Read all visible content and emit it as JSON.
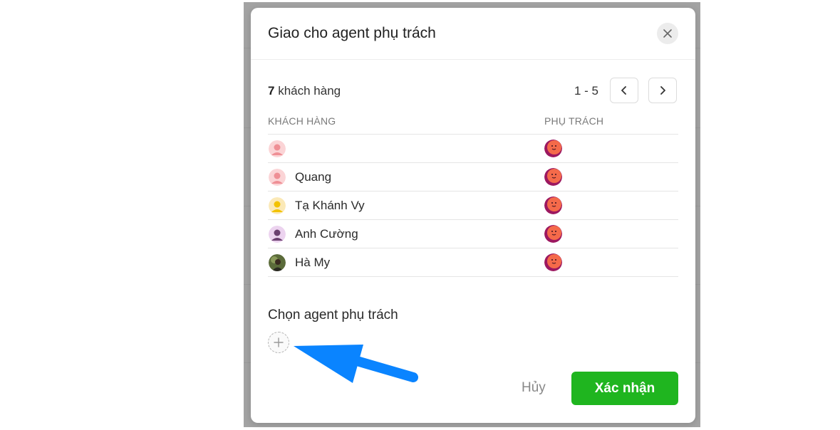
{
  "modal": {
    "title": "Giao cho agent phụ trách",
    "close_icon": "close-icon"
  },
  "summary": {
    "count": "7",
    "count_label": "khách hàng",
    "page_range": "1 - 5"
  },
  "table": {
    "headers": {
      "customer": "KHÁCH HÀNG",
      "agent": "PHỤ TRÁCH"
    },
    "rows": [
      {
        "name": "",
        "avatar": "pink-default-avatar",
        "agent_avatar": "agent-avatar"
      },
      {
        "name": "Quang",
        "avatar": "pink-default-avatar",
        "agent_avatar": "agent-avatar"
      },
      {
        "name": "Tạ Khánh Vy",
        "avatar": "yellow-default-avatar",
        "agent_avatar": "agent-avatar"
      },
      {
        "name": "Anh Cường",
        "avatar": "purple-default-avatar",
        "agent_avatar": "agent-avatar"
      },
      {
        "name": "Hà My",
        "avatar": "photo-avatar",
        "agent_avatar": "agent-avatar"
      }
    ]
  },
  "assign": {
    "label": "Chọn agent phụ trách",
    "add_icon": "plus-icon"
  },
  "footer": {
    "cancel_label": "Hủy",
    "confirm_label": "Xác nhận"
  },
  "colors": {
    "confirm": "#1fb51f",
    "arrow": "#0a84ff"
  }
}
